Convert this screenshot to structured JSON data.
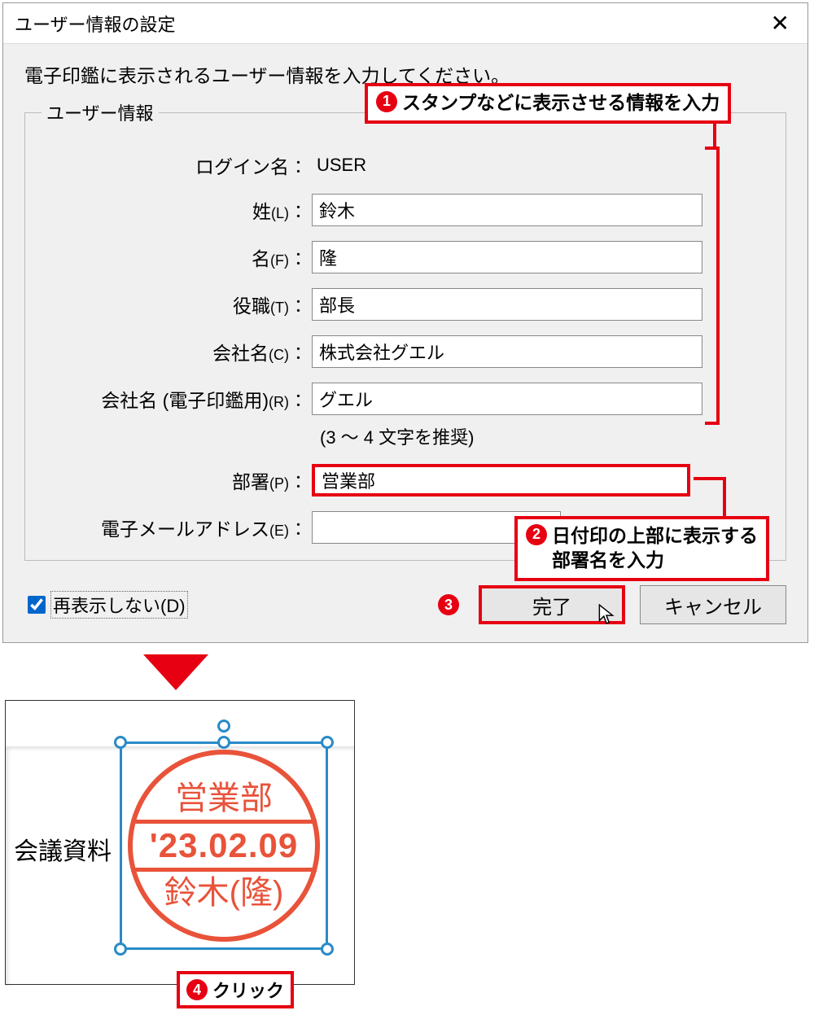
{
  "dialog": {
    "title": "ユーザー情報の設定",
    "instruction": "電子印鑑に表示されるユーザー情報を入力してください。",
    "group_legend": "ユーザー情報",
    "fields": {
      "login": {
        "label": "ログイン名",
        "suffix": "",
        "value": "USER"
      },
      "last": {
        "label": "姓",
        "suffix": "(L)",
        "value": "鈴木"
      },
      "first": {
        "label": "名",
        "suffix": "(F)",
        "value": "隆"
      },
      "title": {
        "label": "役職",
        "suffix": "(T)",
        "value": "部長"
      },
      "company": {
        "label": "会社名",
        "suffix": "(C)",
        "value": "株式会社グエル"
      },
      "company_stamp": {
        "label": "会社名 (電子印鑑用)",
        "suffix": "(R)",
        "value": "グエル"
      },
      "dept": {
        "label": "部署",
        "suffix": "(P)",
        "value": "営業部"
      },
      "email": {
        "label": "電子メールアドレス",
        "suffix": "(E)",
        "value": ""
      }
    },
    "company_stamp_hint": "(3 ～ 4 文字を推奨)",
    "dont_show_again": {
      "label": "再表示しない(D)",
      "checked": true
    },
    "buttons": {
      "ok": "完了",
      "cancel": "キャンセル"
    }
  },
  "callouts": {
    "c1": "スタンプなどに表示させる情報を入力",
    "c2_line1": "日付印の上部に表示する",
    "c2_line2": "部署名を入力",
    "c4": "クリック"
  },
  "result": {
    "doc_text": "会議資料",
    "stamp_top": "営業部",
    "stamp_date": "'23.02.09",
    "stamp_bottom": "鈴木(隆)"
  }
}
